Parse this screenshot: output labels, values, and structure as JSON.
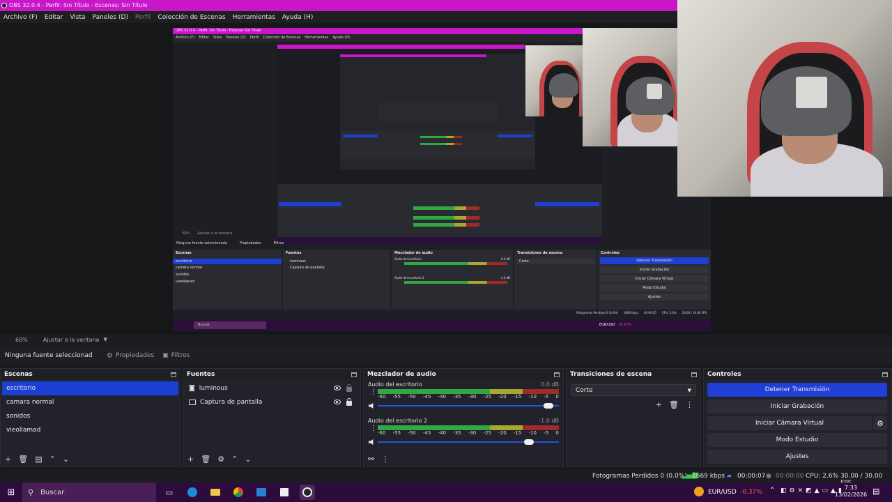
{
  "window": {
    "title": "OBS 32.0.4 - Perfil: Sin Título - Escenas: Sin Título"
  },
  "menu": {
    "items": [
      "Archivo (F)",
      "Editar",
      "Vista",
      "Paneles (D)",
      "Perfil",
      "Colección de Escenas",
      "Herramientas",
      "Ayuda (H)"
    ]
  },
  "preview": {
    "nested_title": "OBS 32.0.4 - Perfil: Sin Título - Escenas Sin Título",
    "nested_menu": [
      "Archivo (F)",
      "Editar",
      "Vista",
      "Paneles (D)",
      "Perfil",
      "Colección de Escenas",
      "Herramientas",
      "Ayuda (H)"
    ],
    "nested_zoom": "60%",
    "nested_fit": "Ajustar a la ventana",
    "nested_no_source": "Ninguna fuente seleccionada",
    "nested_props": "Propiedades",
    "nested_filters": "Filtros",
    "nested_scenes_h": "Escenas",
    "nested_scenes": [
      "escritorio",
      "camara normal",
      "sonidos",
      "vieollamad"
    ],
    "nested_sources_h": "Fuentes",
    "nested_sources": [
      "luminous",
      "Captura de pantalla"
    ],
    "nested_mixer_h": "Mezclador de audio",
    "nested_mixer": [
      {
        "name": "Audio del escritorio",
        "db": "0.0 dB"
      },
      {
        "name": "Audio del escritorio 2",
        "db": "-1.0 dB"
      }
    ],
    "nested_trans_h": "Transiciones de escena",
    "nested_trans": "Corte",
    "nested_ctrl_h": "Controles",
    "nested_ctrl": [
      "Detener Transmisión",
      "Iniciar Grabación",
      "Iniciar Cámara Virtual",
      "Modo Estudio",
      "Ajustes"
    ],
    "nested_status": "Fotogramas Perdidos 0 (0.0%)",
    "nested_kbps": "1669 kbps",
    "nested_time": "00:00:05",
    "nested_cpu": "CPU: 2.6%",
    "nested_fps": "30.00 / 30.00 FPS",
    "nested_search": "Buscar",
    "nested_ticker": "EUR/USD",
    "nested_change": "-0.37%"
  },
  "zoom": {
    "level": "60%",
    "fit": "Ajustar a la ventana"
  },
  "props": {
    "no_source": "Ninguna fuente seleccionad",
    "properties": "Propiedades",
    "filters": "Filtros"
  },
  "scenes": {
    "header": "Escenas",
    "items": [
      "escritorio",
      "camara normal",
      "sonidos",
      "vieollamad"
    ]
  },
  "sources": {
    "header": "Fuentes",
    "items": [
      "luminous",
      "Captura de pantalla"
    ]
  },
  "mixer": {
    "header": "Mezclador de audio",
    "channels": [
      {
        "name": "Audio del escritorio",
        "db": "0.0 dB",
        "volume": 0.97
      },
      {
        "name": "Audio del escritorio 2",
        "db": "-1.0 dB",
        "volume": 0.86
      }
    ],
    "ticks": [
      "-60",
      "-55",
      "-50",
      "-45",
      "-40",
      "-35",
      "-30",
      "-25",
      "-20",
      "-15",
      "-10",
      "-5",
      "0"
    ]
  },
  "transitions": {
    "header": "Transiciones de escena",
    "selected": "Corte"
  },
  "controls": {
    "header": "Controles",
    "stop_stream": "Detener Transmisión",
    "start_record": "Iniciar Grabación",
    "start_vcam": "Iniciar Cámara Virtual",
    "studio_mode": "Modo Estudio",
    "settings": "Ajustes"
  },
  "status": {
    "dropped": "Fotogramas Perdidos 0 (0.0%)",
    "kbps": "1669 kbps",
    "stream_time": "00:00:07",
    "rec_time": "00:00:00",
    "cpu": "CPU: 2.6%",
    "fps": "30.00 / 30.00 FPS"
  },
  "taskbar": {
    "search": "Buscar",
    "ticker": "EUR/USD",
    "change": "-0.37%",
    "time": "7:33",
    "date": "13/02/2026"
  },
  "colors": {
    "accent": "#1f3fd6",
    "titlebar": "#c916c9",
    "taskbar": "#2b0c3c",
    "negative": "#ff5b5b"
  }
}
